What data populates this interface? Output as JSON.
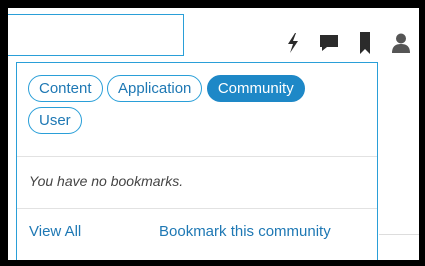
{
  "search": {
    "value": ""
  },
  "toolbar": {
    "icons": [
      "lightning-icon",
      "chat-icon",
      "bookmark-icon",
      "user-icon"
    ]
  },
  "bookmarks": {
    "tabs": [
      {
        "label": "Content",
        "active": false
      },
      {
        "label": "Application",
        "active": false
      },
      {
        "label": "Community",
        "active": true
      },
      {
        "label": "User",
        "active": false
      }
    ],
    "empty_message": "You have no bookmarks.",
    "view_all_label": "View All",
    "bookmark_label": "Bookmark this community"
  },
  "colors": {
    "accent": "#1e88c7",
    "border": "#2a9fd8",
    "icon": "#2b2b2b",
    "background": "#000000"
  }
}
